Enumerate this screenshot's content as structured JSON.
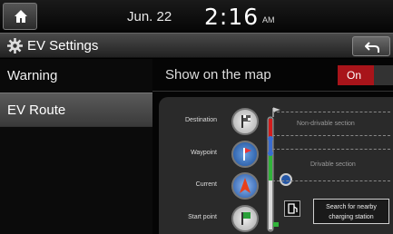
{
  "status": {
    "date": "Jun. 22",
    "time": "2:16",
    "ampm": "AM"
  },
  "title": {
    "text": "EV Settings"
  },
  "sidebar": {
    "items": [
      {
        "label": "Warning"
      },
      {
        "label": "EV Route"
      }
    ]
  },
  "content": {
    "show_on_map": {
      "label": "Show on the map",
      "toggle_label": "On"
    },
    "legend": {
      "destination": "Destination",
      "waypoint": "Waypoint",
      "current": "Current",
      "start_point": "Start point",
      "non_drivable": "Non-drivable section",
      "drivable": "Drivable section",
      "search_line1": "Search for nearby",
      "search_line2": "charging station"
    }
  },
  "colors": {
    "toggle_on": "#a8141a",
    "drivable_bar": "#31b33a",
    "non_drivable_bar": "#d21d1d"
  }
}
